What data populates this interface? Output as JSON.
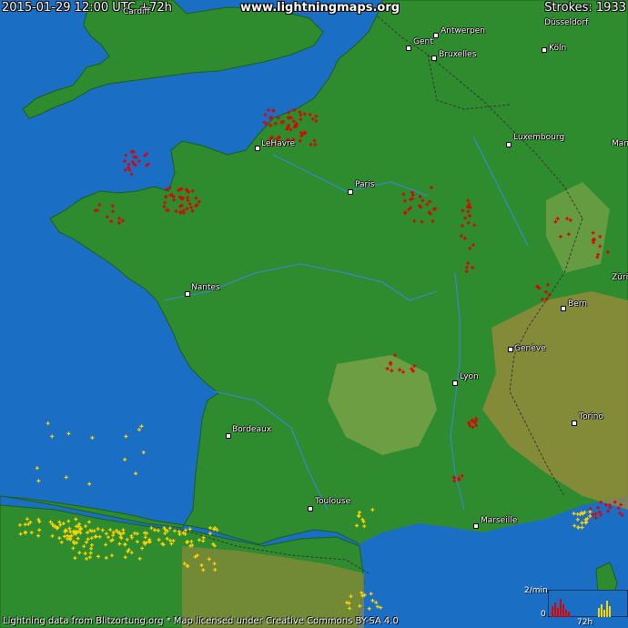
{
  "header": {
    "timestamp": "2015-01-29 12:00 UTC +72h",
    "site": "www.lightningmaps.org",
    "strokes": "Strokes: 1933"
  },
  "footer": {
    "attribution": "Lightning data from Blitzortung.org  *  Map licensed under Creative Commons BY-SA 4.0"
  },
  "legend": {
    "rate_label": "2/min",
    "zero_label": "0",
    "time_label": "72h"
  },
  "cities": [
    {
      "key": "cardiff",
      "label": "Cardiff"
    },
    {
      "key": "gent",
      "label": "Gent"
    },
    {
      "key": "antwerpen",
      "label": "Antwerpen"
    },
    {
      "key": "bruxelles",
      "label": "Bruxelles"
    },
    {
      "key": "koln",
      "label": "Köln"
    },
    {
      "key": "dusseldorf",
      "label": "Düsseldorf"
    },
    {
      "key": "luxembourg",
      "label": "Luxembourg"
    },
    {
      "key": "lehavre",
      "label": "LeHavre"
    },
    {
      "key": "paris",
      "label": "Paris"
    },
    {
      "key": "nantes",
      "label": "Nantes"
    },
    {
      "key": "bern",
      "label": "Bern"
    },
    {
      "key": "geneve",
      "label": "Genève"
    },
    {
      "key": "lyon",
      "label": "Lyon"
    },
    {
      "key": "bordeaux",
      "label": "Bordeaux"
    },
    {
      "key": "torino",
      "label": "Torino"
    },
    {
      "key": "toulouse",
      "label": "Toulouse"
    },
    {
      "key": "marseille",
      "label": "Marseille"
    },
    {
      "key": "mannheim",
      "label": "Mann"
    },
    {
      "key": "zurich",
      "label": "Züri"
    }
  ],
  "colors": {
    "sea": "#1a6fc4",
    "land": "#2e8b2e",
    "highland": "#a08a3c",
    "recent_strike": "#e00000",
    "older_strike": "#ffd400"
  }
}
